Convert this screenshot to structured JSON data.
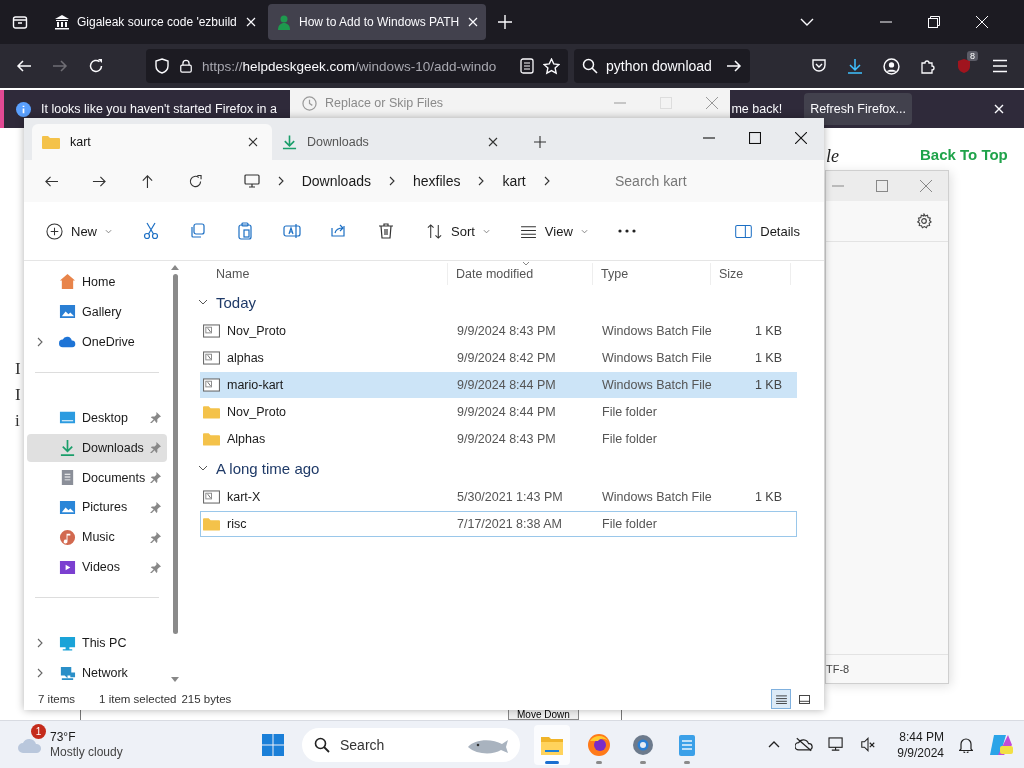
{
  "browser": {
    "tabs": [
      {
        "title": "Gigaleak source code 'ezbuild",
        "selected": false
      },
      {
        "title": "How to Add to Windows PATH",
        "selected": true
      }
    ],
    "url": {
      "scheme": "https://",
      "host": "helpdeskgeek.com",
      "path": "/windows-10/add-windo"
    },
    "search_value": "python download",
    "extension_badge": "8",
    "notification": {
      "text_start": "It looks like you haven't started Firefox in a",
      "text_end": "me back!",
      "button": "Refresh Firefox..."
    }
  },
  "webpage": {
    "title_fragment": "le",
    "back_to_top": "Back To Top",
    "text_fragments": [
      "I",
      "I",
      "i"
    ],
    "move_down": "Move Down"
  },
  "replace_dialog": {
    "title": "Replace or Skip Files"
  },
  "background_window": {
    "status_fragment": "TF-8"
  },
  "explorer": {
    "tabs": [
      {
        "title": "kart",
        "selected": true
      },
      {
        "title": "Downloads",
        "selected": false
      }
    ],
    "breadcrumb": [
      "Downloads",
      "hexfiles",
      "kart"
    ],
    "search": {
      "placeholder": "Search kart"
    },
    "toolbar": [
      {
        "kind": "new",
        "label": "New"
      },
      {
        "kind": "cut"
      },
      {
        "kind": "copy"
      },
      {
        "kind": "paste"
      },
      {
        "kind": "rename"
      },
      {
        "kind": "share"
      },
      {
        "kind": "delete"
      },
      {
        "kind": "sort",
        "label": "Sort"
      },
      {
        "kind": "view",
        "label": "View"
      },
      {
        "kind": "more"
      },
      {
        "kind": "details",
        "label": "Details"
      }
    ],
    "nav": [
      {
        "section": [
          {
            "label": "Home",
            "kind": "home",
            "expandable": false,
            "pinned": false,
            "selected": false
          },
          {
            "label": "Gallery",
            "kind": "gallery",
            "expandable": false,
            "pinned": false,
            "selected": false
          },
          {
            "label": "OneDrive",
            "kind": "cloud",
            "expandable": true,
            "pinned": false,
            "selected": false
          }
        ]
      },
      {
        "section": [
          {
            "label": "Desktop",
            "kind": "desktop",
            "expandable": false,
            "pinned": true,
            "selected": false
          },
          {
            "label": "Downloads",
            "kind": "download",
            "expandable": false,
            "pinned": true,
            "selected": true
          },
          {
            "label": "Documents",
            "kind": "documents",
            "expandable": false,
            "pinned": true,
            "selected": false
          },
          {
            "label": "Pictures",
            "kind": "pictures",
            "expandable": false,
            "pinned": true,
            "selected": false
          },
          {
            "label": "Music",
            "kind": "music",
            "expandable": false,
            "pinned": true,
            "selected": false
          },
          {
            "label": "Videos",
            "kind": "videos",
            "expandable": false,
            "pinned": true,
            "selected": false
          }
        ]
      },
      {
        "section": [
          {
            "label": "This PC",
            "kind": "pc",
            "expandable": true,
            "pinned": false,
            "selected": false
          },
          {
            "label": "Network",
            "kind": "network",
            "expandable": true,
            "pinned": false,
            "selected": false
          }
        ]
      }
    ],
    "columns": [
      "Name",
      "Date modified",
      "Type",
      "Size"
    ],
    "groups": [
      {
        "title": "Today",
        "expanded": true,
        "files": [
          {
            "name": "Nov_Proto",
            "date": "9/9/2024 8:43 PM",
            "type": "Windows Batch File",
            "size": "1 KB",
            "kind": "batch",
            "selected": false,
            "focused": false
          },
          {
            "name": "alphas",
            "date": "9/9/2024 8:42 PM",
            "type": "Windows Batch File",
            "size": "1 KB",
            "kind": "batch",
            "selected": false,
            "focused": false
          },
          {
            "name": "mario-kart",
            "date": "9/9/2024 8:44 PM",
            "type": "Windows Batch File",
            "size": "1 KB",
            "kind": "batch",
            "selected": true,
            "focused": false
          },
          {
            "name": "Nov_Proto",
            "date": "9/9/2024 8:44 PM",
            "type": "File folder",
            "kind": "folder",
            "selected": false,
            "focused": false
          },
          {
            "name": "Alphas",
            "date": "9/9/2024 8:43 PM",
            "type": "File folder",
            "kind": "folder",
            "selected": false,
            "focused": false
          }
        ]
      },
      {
        "title": "A long time ago",
        "expanded": true,
        "files": [
          {
            "name": "kart-X",
            "date": "5/30/2021 1:43 PM",
            "type": "Windows Batch File",
            "size": "1 KB",
            "kind": "batch",
            "selected": false,
            "focused": false
          },
          {
            "name": "risc",
            "date": "7/17/2021 8:38 AM",
            "type": "File folder",
            "kind": "folder",
            "selected": false,
            "focused": true
          }
        ]
      }
    ],
    "status": {
      "count": "7 items",
      "selection": "1 item selected",
      "bytes": "215 bytes"
    },
    "view_modes": [
      {
        "kind": "list",
        "selected": true
      },
      {
        "kind": "tiles",
        "selected": false
      }
    ]
  },
  "taskbar": {
    "weather": {
      "badge": "1",
      "temperature": "73°F",
      "condition": "Mostly cloudy"
    },
    "search": {
      "placeholder": "Search"
    },
    "apps": [
      {
        "kind": "start",
        "active": false,
        "running": false
      },
      {
        "kind": "explorer",
        "active": true,
        "running": true
      },
      {
        "kind": "firefox",
        "active": false,
        "running": true
      },
      {
        "kind": "settings",
        "active": false,
        "running": true
      },
      {
        "kind": "notepad",
        "active": false,
        "running": true
      }
    ],
    "time": "8:44 PM",
    "date": "9/9/2024"
  }
}
